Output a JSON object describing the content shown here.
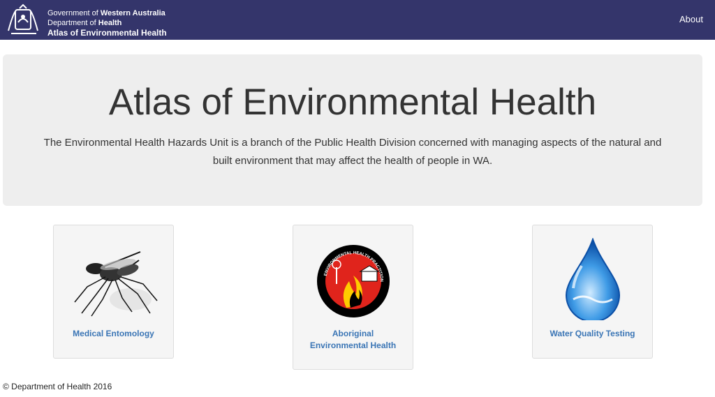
{
  "header": {
    "gov_prefix": "Government of ",
    "gov_name": "Western Australia",
    "dept_prefix": "Department of ",
    "dept_name": "Health",
    "atlas": "Atlas of Environmental Health",
    "nav_about": "About",
    "bg_color": "#34356b"
  },
  "hero": {
    "title": "Atlas of Environmental Health",
    "description": "The Environmental Health Hazards Unit is a branch of the Public Health Division concerned with managing aspects of the natural and built environment that may affect the health of people in WA."
  },
  "cards": [
    {
      "label": "Medical Entomology",
      "icon": "mosquito-icon"
    },
    {
      "label_line1": "Aboriginal",
      "label_line2": "Environmental Health",
      "icon": "aboriginal-env-health-logo",
      "logo_ring_text": "ENVIRONMENTAL HEALTH PRACTITIONERS"
    },
    {
      "label": "Water Quality Testing",
      "icon": "water-drop-icon"
    }
  ],
  "footer": {
    "copyright": "© Department of Health 2016"
  },
  "colors": {
    "link": "#3a75b5",
    "card_bg": "#f5f5f5",
    "hero_bg": "#eeeeee"
  }
}
